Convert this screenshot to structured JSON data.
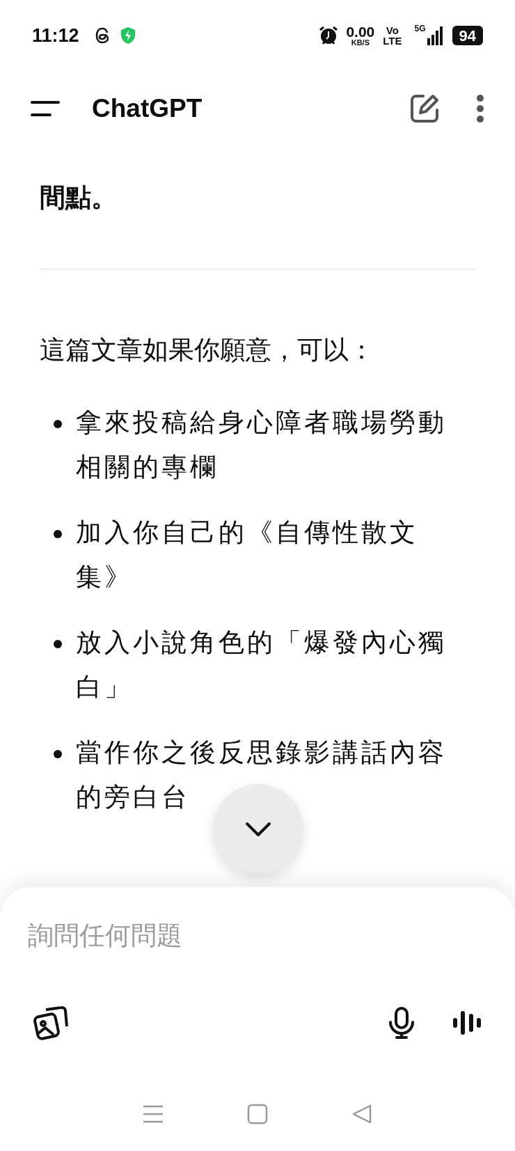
{
  "status_bar": {
    "time": "11:12",
    "net_speed": "0.00",
    "net_unit": "KB/S",
    "volte_top": "Vo",
    "volte_bottom": "LTE",
    "network": "5G",
    "battery": "94"
  },
  "header": {
    "title": "ChatGPT"
  },
  "message": {
    "lead_end": "間點。",
    "intro": "這篇文章如果你願意，可以：",
    "bullets": [
      "拿來投稿給身心障者職場勞動相關的專欄",
      "加入你自己的《自傳性散文集》",
      "放入小說角色的「爆發內心獨白」",
      "當作你之後反思錄影講話內容的旁白台"
    ]
  },
  "composer": {
    "placeholder": "詢問任何問題"
  }
}
